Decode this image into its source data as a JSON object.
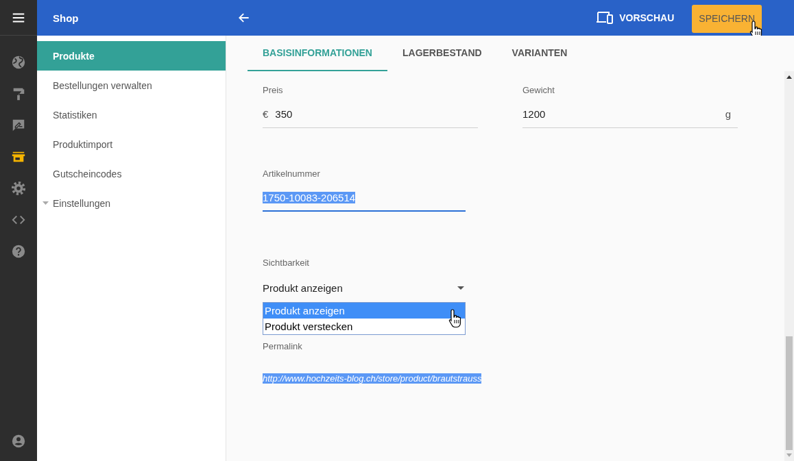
{
  "rail": {
    "items": [
      {
        "kind": "globe",
        "selected": false
      },
      {
        "kind": "roller",
        "selected": false
      },
      {
        "kind": "feedback",
        "selected": false
      },
      {
        "kind": "store",
        "selected": true
      },
      {
        "kind": "gear",
        "selected": false
      },
      {
        "kind": "code",
        "selected": false
      },
      {
        "kind": "help",
        "selected": false
      }
    ],
    "footer": {
      "kind": "account",
      "selected": false
    }
  },
  "header": {
    "title": "Shop",
    "preview_label": "VORSCHAU",
    "save_label": "SPEICHERN"
  },
  "sidebar": {
    "items": [
      {
        "label": "Produkte",
        "kind": "link",
        "selected": true
      },
      {
        "label": "Bestellungen verwalten",
        "kind": "link",
        "selected": false
      },
      {
        "label": "Statistiken",
        "kind": "link",
        "selected": false
      },
      {
        "label": "Produktimport",
        "kind": "link",
        "selected": false
      },
      {
        "label": "Gutscheincodes",
        "kind": "link",
        "selected": false
      },
      {
        "label": "Einstellungen",
        "kind": "group",
        "selected": false
      }
    ]
  },
  "tabs": [
    {
      "label": "BASISINFORMATIONEN",
      "selected": true
    },
    {
      "label": "LAGERBESTAND",
      "selected": false
    },
    {
      "label": "VARIANTEN",
      "selected": false
    }
  ],
  "form": {
    "price": {
      "label": "Preis",
      "prefix": "€",
      "value": "350"
    },
    "weight": {
      "label": "Gewicht",
      "value": "1200",
      "suffix": "g"
    },
    "article_number": {
      "label": "Artikelnummer",
      "value": "1750-10083-206514",
      "focused": true,
      "highlighted": true
    },
    "visibility": {
      "label": "Sichtbarkeit",
      "value": "Produkt anzeigen",
      "expanded": true,
      "options": [
        {
          "label": "Produkt anzeigen",
          "selected": true
        },
        {
          "label": "Produkt verstecken",
          "selected": false
        }
      ]
    },
    "permalink": {
      "label": "Permalink",
      "value": "http://www.hochzeits-blog.ch/store/product/brautstrauss",
      "highlighted": true
    }
  }
}
